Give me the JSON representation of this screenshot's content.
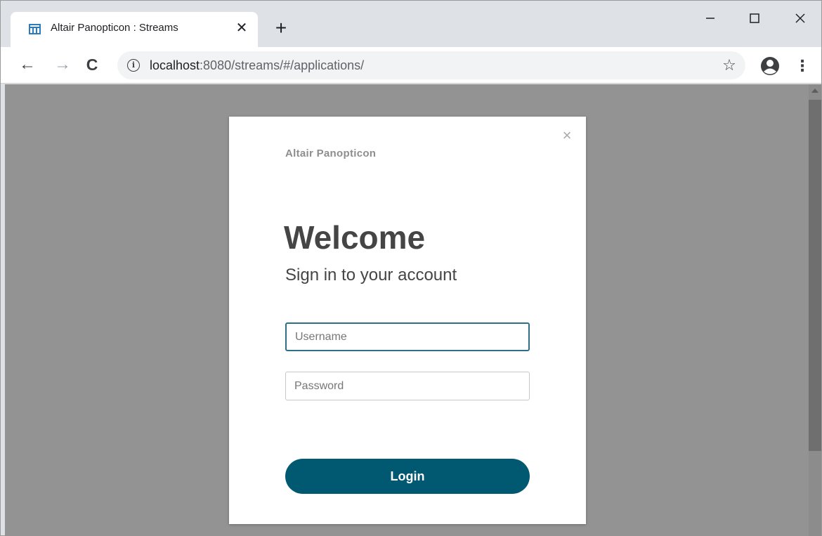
{
  "tab": {
    "title": "Altair Panopticon : Streams",
    "close_glyph": "✕",
    "favicon": "panopticon-favicon-icon"
  },
  "new_tab_glyph": "+",
  "window_controls": {
    "minimize_glyph": "—",
    "maximize_glyph": "☐",
    "close_glyph": "✕"
  },
  "toolbar": {
    "back_glyph": "←",
    "forward_glyph": "→",
    "reload_glyph": "C",
    "info_glyph": "i",
    "url_host": "localhost",
    "url_rest": ":8080/streams/#/applications/",
    "star_glyph": "☆",
    "menu_glyph": "⋮"
  },
  "modal": {
    "close_glyph": "×",
    "brand": "Altair Panopticon",
    "heading": "Welcome",
    "subtitle": "Sign in to your account",
    "username_placeholder": "Username",
    "password_placeholder": "Password",
    "login_label": "Login"
  },
  "colors": {
    "overlay": "#939393",
    "login_button": "#005871",
    "username_focus_border": "#2f6e87",
    "tabstrip": "#dee1e6"
  }
}
